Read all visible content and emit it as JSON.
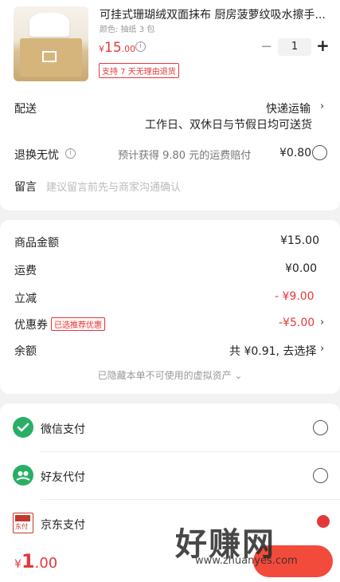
{
  "product": {
    "title": "可挂式珊瑚绒双面抹布 厨房菠萝纹吸水擦手...",
    "spec": "颜色: 抽纸 3 包",
    "price_symbol": "¥",
    "price_main": "15",
    "price_dec": ".00",
    "info_icon": "i",
    "minus": "−",
    "quantity": "1",
    "plus": "+",
    "badge": "支持 7 天无理由退货"
  },
  "delivery": {
    "label": "配送",
    "method": "快递运输",
    "note": "工作日、双休日与节假日均可送货",
    "chevron": "›"
  },
  "return": {
    "label": "退换无忧",
    "info_icon": "i",
    "note": "预计获得 9.80 元的运费赔付",
    "price": "¥0.80"
  },
  "message": {
    "label": "留言",
    "placeholder": "建议留言前先与商家沟通确认"
  },
  "summary": {
    "goods_label": "商品金额",
    "goods_value": "¥15.00",
    "shipping_label": "运费",
    "shipping_value": "¥0.00",
    "discount_label": "立减",
    "discount_value": "- ¥9.00",
    "coupon_label": "优惠券",
    "coupon_tag": "已选推荐优惠",
    "coupon_value": "-¥5.00",
    "balance_label": "余额",
    "balance_value": "共 ¥0.91,  去选择",
    "chevron": "›",
    "hidden_note": "已隐藏本单不可使用的虚拟资产 ⌄"
  },
  "payment": {
    "wechat": "微信支付",
    "friend": "好友代付",
    "jd": "京东支付",
    "jd_icon_text": "东付"
  },
  "footer": {
    "total_symbol": "¥",
    "total_main": "1",
    "total_dec": ".00"
  },
  "watermark": {
    "text": "好赚网",
    "url": "www.zhuanyes.com"
  },
  "colors": {
    "accent": "#e4393c",
    "wechat_green": "#2aae67",
    "background": "#f2f2f2"
  }
}
